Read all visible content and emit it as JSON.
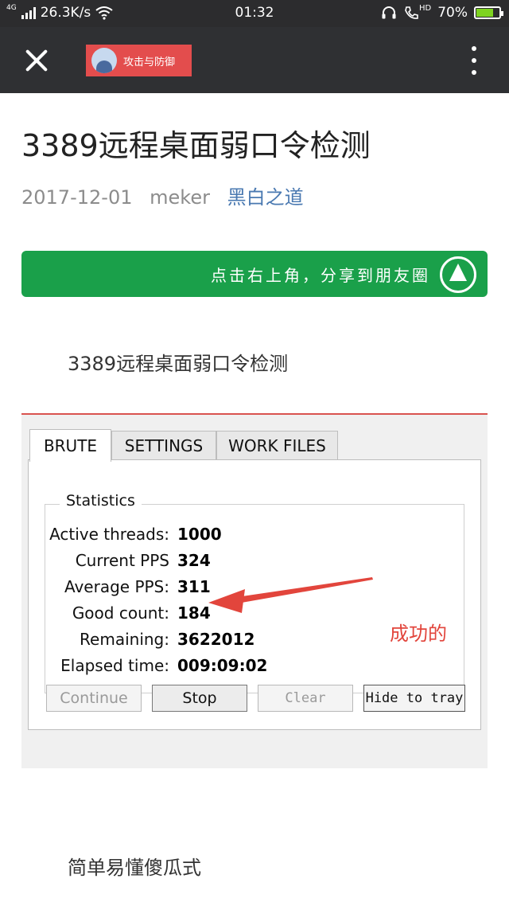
{
  "status_bar": {
    "network_type": "4G",
    "speed": "26.3K/s",
    "time": "01:32",
    "hd": "HD",
    "battery": "70%",
    "battery_level": 0.7,
    "icons": [
      "signal-icon",
      "wifi-icon",
      "headset-icon",
      "call-hd-icon",
      "battery-icon"
    ]
  },
  "nav": {
    "account_name": "攻击与防御",
    "account_color": "#e34d4d",
    "icons": [
      "close-icon",
      "more-icon"
    ]
  },
  "article": {
    "title": "3389远程桌面弱口令检测",
    "date": "2017-12-01",
    "author": "meker",
    "source": "黑白之道",
    "share_text": "点击右上角，分享到朋友圈",
    "paragraph_1": "3389远程桌面弱口令检测",
    "paragraph_2": "简单易懂傻瓜式",
    "accent_color": "#1aa04a",
    "link_color": "#4a79b1"
  },
  "screenshot": {
    "tabs": [
      "BRUTE",
      "SETTINGS",
      "WORK FILES"
    ],
    "active_tab": "BRUTE",
    "group_label": "Statistics",
    "stats": [
      {
        "label": "Active threads:",
        "value": "1000"
      },
      {
        "label": "Current PPS",
        "value": "324"
      },
      {
        "label": "Average PPS:",
        "value": "311"
      },
      {
        "label": "Good count:",
        "value": "184"
      },
      {
        "label": "Remaining:",
        "value": "3622012"
      },
      {
        "label": "Elapsed time:",
        "value": "009:09:02"
      }
    ],
    "buttons": {
      "continue": "Continue",
      "stop": "Stop",
      "clear": "Clear",
      "hide": "Hide to tray"
    },
    "annotation": "成功的",
    "annotation_color": "#e2453c"
  }
}
